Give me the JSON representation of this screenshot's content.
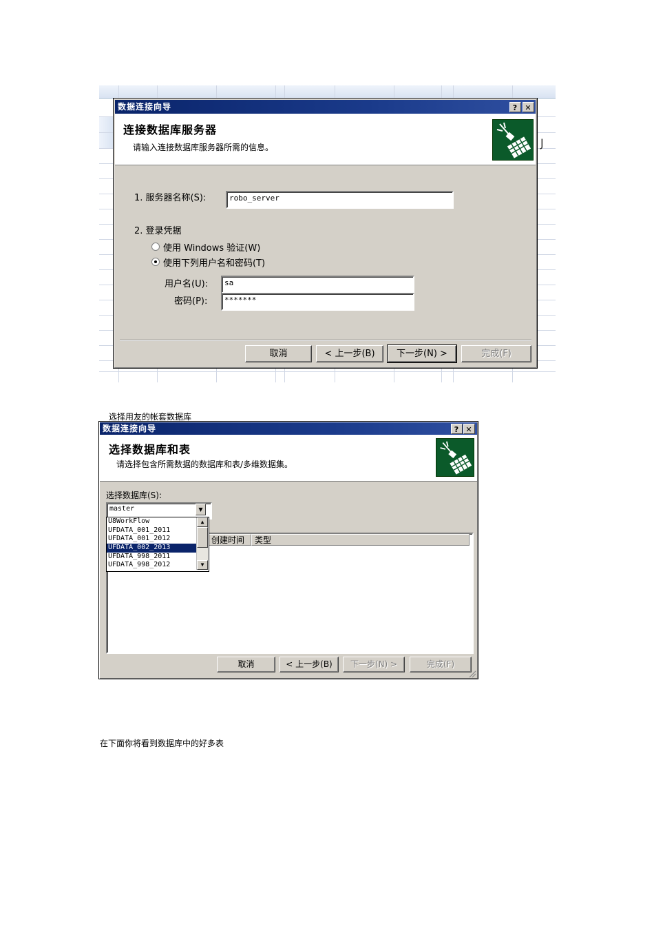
{
  "dialog1": {
    "title": "数据连接向导",
    "help_label": "?",
    "close_label": "✕",
    "header_title": "连接数据库服务器",
    "header_subtitle": "请输入连接数据库服务器所需的信息。",
    "sheet_col_letter": "J",
    "step1_label": "1.  服务器名称(S):",
    "server_value": "robo_server",
    "step2_label": "2.  登录凭据",
    "radio_windows_label": "使用 Windows 验证(W)",
    "radio_user_label": "使用下列用户名和密码(T)",
    "username_label": "用户名(U):",
    "username_value": "sa",
    "password_label": "密码(P):",
    "password_value": "*******",
    "buttons": {
      "cancel": "取消",
      "back": "< 上一步(B)",
      "next": "下一步(N) >",
      "finish": "完成(F)"
    }
  },
  "caption1": "选择用友的帐套数据库",
  "dialog2": {
    "title": "数据连接向导",
    "help_label": "?",
    "close_label": "✕",
    "header_title": "选择数据库和表",
    "header_subtitle": "请选择包含所需数据的数据库和表/多维数据集。",
    "database_label": "选择数据库(S):",
    "database_selected": "master",
    "database_options": [
      "U8WorkFlow",
      "UFDATA_001_2011",
      "UFDATA_001_2012",
      "UFDATA_002_2013",
      "UFDATA_998_2011",
      "UFDATA_998_2012"
    ],
    "selected_index": 3,
    "columns": [
      "创建时间",
      "类型"
    ],
    "buttons": {
      "cancel": "取消",
      "back": "< 上一步(B)",
      "next": "下一步(N) >",
      "finish": "完成(F)"
    }
  },
  "caption2": "在下面你将看到数据库中的好多表"
}
